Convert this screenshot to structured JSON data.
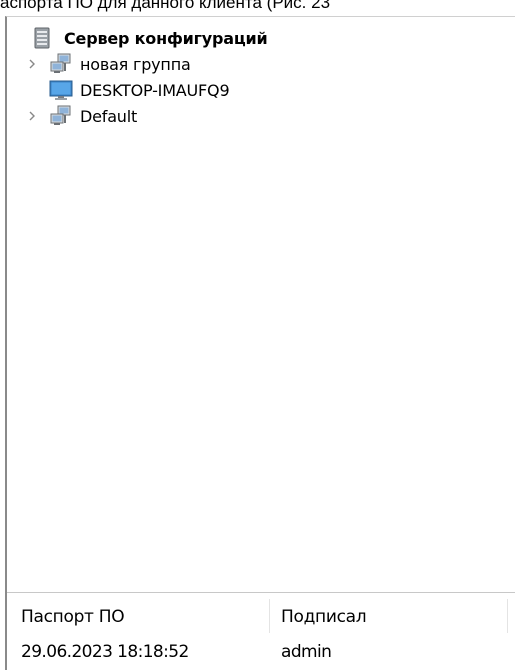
{
  "caption": {
    "text": "аспорта ПО для данного клиента (Рис. 23"
  },
  "tree": {
    "root": {
      "label": "Сервер конфигураций",
      "icon": "server-icon"
    },
    "items": [
      {
        "label": "новая группа",
        "icon": "network-group-icon",
        "expandable": true
      },
      {
        "label": "DESKTOP-IMAUFQ9",
        "icon": "monitor-icon",
        "expandable": false
      },
      {
        "label": "Default",
        "icon": "network-group-icon",
        "expandable": true
      }
    ]
  },
  "table": {
    "columns": [
      "Паспорт ПО",
      "Подписал"
    ],
    "rows": [
      [
        "29.06.2023 18:18:52",
        "admin"
      ]
    ]
  },
  "colors": {
    "background": "#ffffff",
    "chevron": "#888888",
    "panel_border": "#8a8a8a"
  }
}
